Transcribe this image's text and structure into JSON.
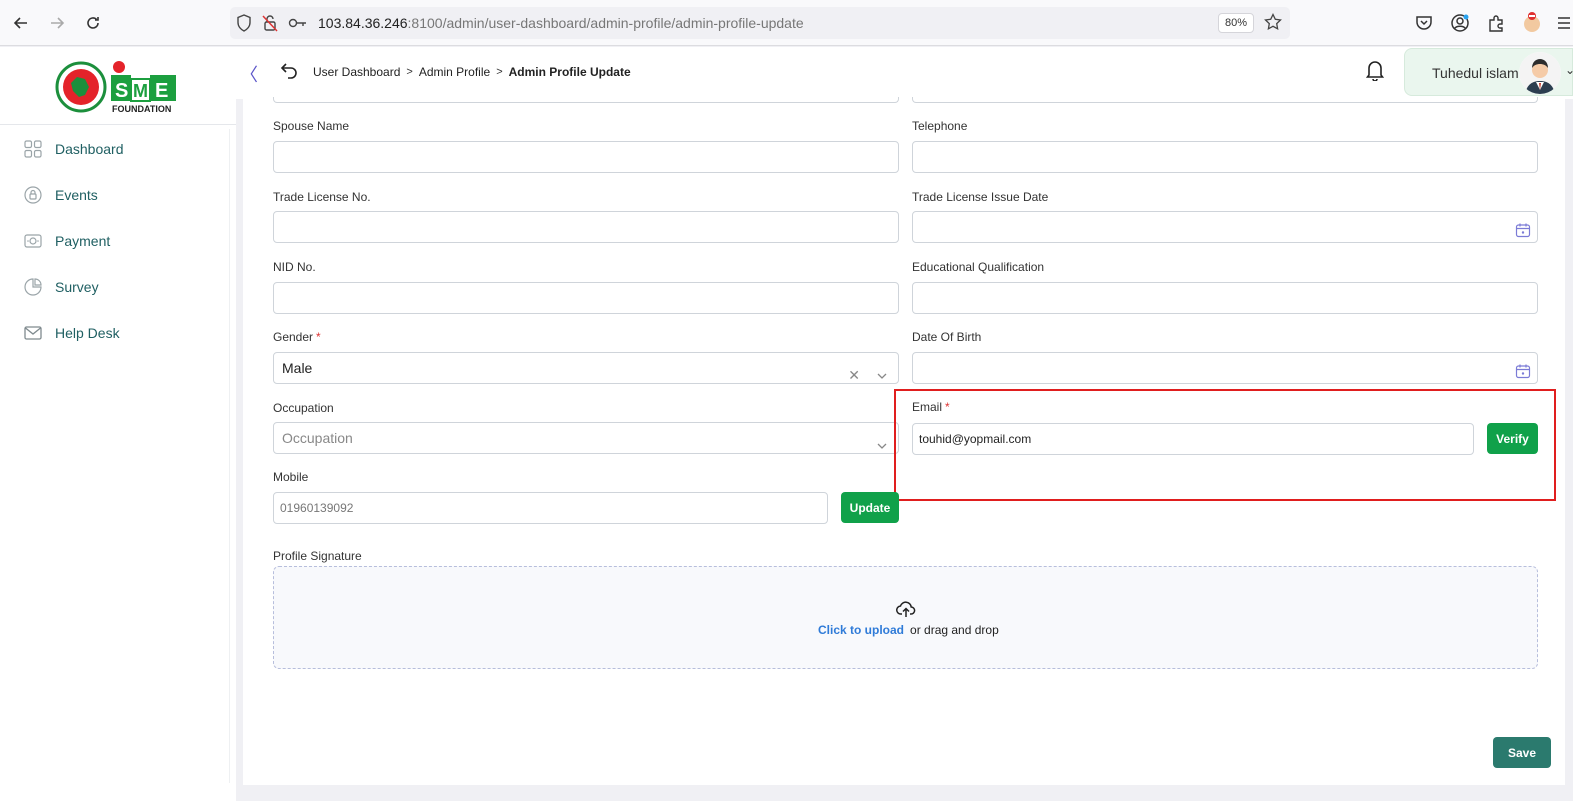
{
  "browser": {
    "url_host": "103.84.36.246",
    "url_rest": ":8100/admin/user-dashboard/admin-profile/admin-profile-update",
    "zoom": "80%"
  },
  "sidebar": {
    "items": [
      {
        "label": "Dashboard",
        "icon": "grid-icon"
      },
      {
        "label": "Events",
        "icon": "lock-icon"
      },
      {
        "label": "Payment",
        "icon": "payment-icon"
      },
      {
        "label": "Survey",
        "icon": "pie-chart-icon"
      },
      {
        "label": "Help Desk",
        "icon": "mail-icon"
      }
    ]
  },
  "header": {
    "breadcrumb": [
      "User Dashboard",
      "Admin Profile",
      "Admin Profile Update"
    ],
    "user_name": "Tuhedul islam"
  },
  "form": {
    "spouse_name": {
      "label": "Spouse Name",
      "value": ""
    },
    "telephone": {
      "label": "Telephone",
      "value": ""
    },
    "trade_license_no": {
      "label": "Trade License No.",
      "value": ""
    },
    "trade_license_issue_date": {
      "label": "Trade License Issue Date",
      "value": ""
    },
    "nid_no": {
      "label": "NID No.",
      "value": ""
    },
    "educational_qualification": {
      "label": "Educational Qualification",
      "value": ""
    },
    "gender": {
      "label": "Gender",
      "required": "*",
      "value": "Male"
    },
    "date_of_birth": {
      "label": "Date Of Birth",
      "value": ""
    },
    "occupation": {
      "label": "Occupation",
      "placeholder": "Occupation"
    },
    "email": {
      "label": "Email",
      "required": "*",
      "value": "touhid@yopmail.com",
      "verify_label": "Verify"
    },
    "mobile": {
      "label": "Mobile",
      "value": "01960139092",
      "update_label": "Update"
    },
    "profile_signature": {
      "label": "Profile Signature",
      "upload_link": "Click to upload",
      "upload_rest": "or drag and drop"
    },
    "save_label": "Save"
  },
  "colors": {
    "accent_green": "#10a14a",
    "save_teal": "#2b7a6e",
    "highlight_red": "#e01e1e",
    "sidebar_text": "#1f5f62"
  }
}
